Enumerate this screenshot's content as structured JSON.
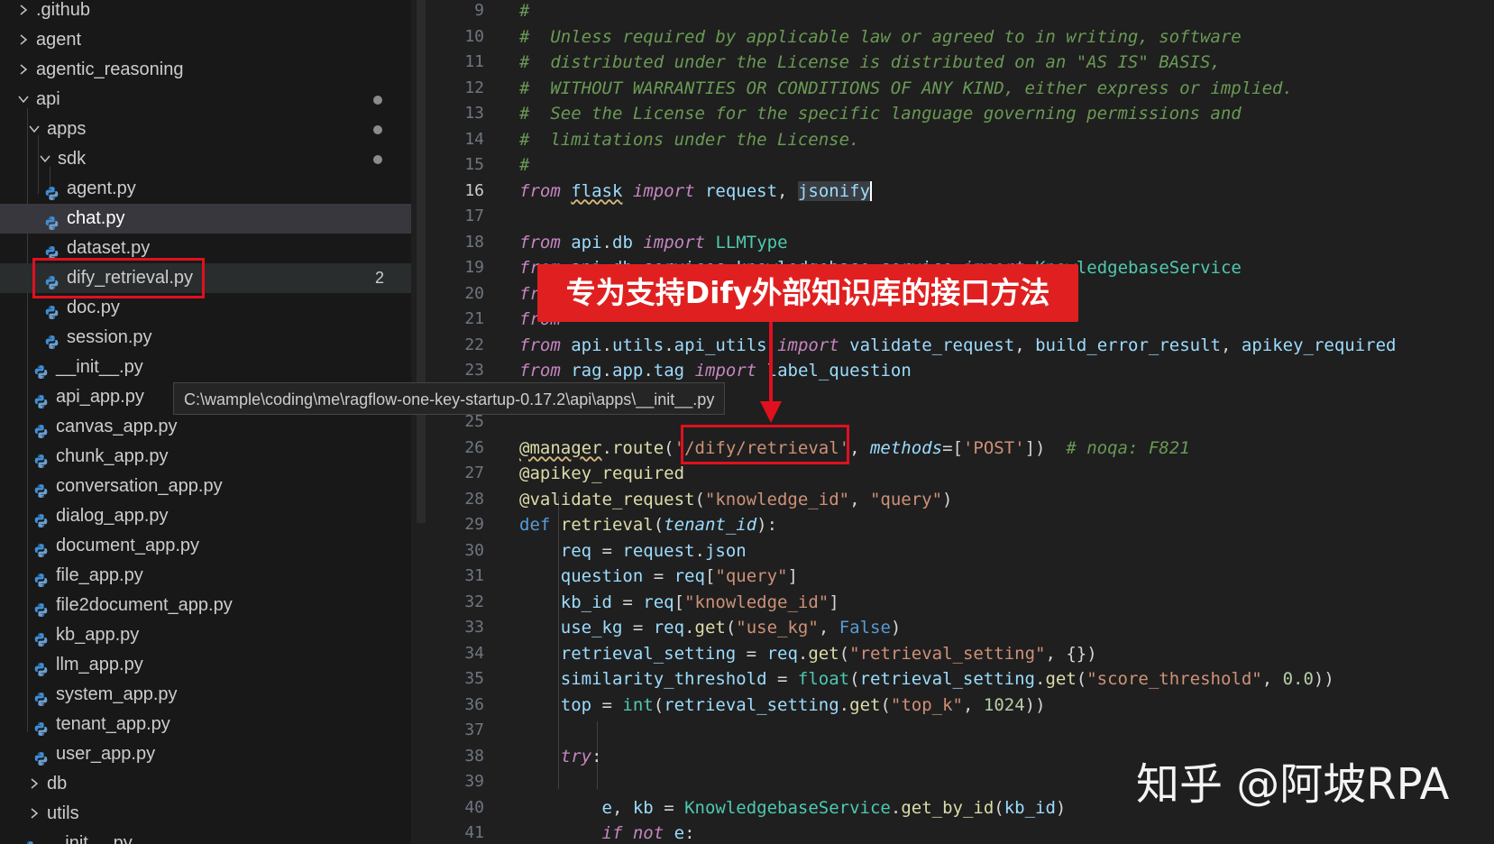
{
  "explorer": {
    "items": [
      {
        "label": ".github",
        "kind": "folder",
        "expanded": false
      },
      {
        "label": "agent",
        "kind": "folder",
        "expanded": false
      },
      {
        "label": "agentic_reasoning",
        "kind": "folder",
        "expanded": false
      },
      {
        "label": "api",
        "kind": "folder",
        "expanded": true
      },
      {
        "label": "apps",
        "kind": "folder",
        "expanded": true
      },
      {
        "label": "sdk",
        "kind": "folder",
        "expanded": true
      },
      {
        "label": "agent.py",
        "kind": "file"
      },
      {
        "label": "chat.py",
        "kind": "file",
        "selected": true
      },
      {
        "label": "dataset.py",
        "kind": "file"
      },
      {
        "label": "dify_retrieval.py",
        "kind": "file",
        "badge": "2"
      },
      {
        "label": "doc.py",
        "kind": "file"
      },
      {
        "label": "session.py",
        "kind": "file"
      },
      {
        "label": "__init__.py",
        "kind": "file"
      },
      {
        "label": "api_app.py",
        "kind": "file"
      },
      {
        "label": "canvas_app.py",
        "kind": "file"
      },
      {
        "label": "chunk_app.py",
        "kind": "file"
      },
      {
        "label": "conversation_app.py",
        "kind": "file"
      },
      {
        "label": "dialog_app.py",
        "kind": "file"
      },
      {
        "label": "document_app.py",
        "kind": "file"
      },
      {
        "label": "file_app.py",
        "kind": "file"
      },
      {
        "label": "file2document_app.py",
        "kind": "file"
      },
      {
        "label": "kb_app.py",
        "kind": "file"
      },
      {
        "label": "llm_app.py",
        "kind": "file"
      },
      {
        "label": "system_app.py",
        "kind": "file"
      },
      {
        "label": "tenant_app.py",
        "kind": "file"
      },
      {
        "label": "user_app.py",
        "kind": "file"
      },
      {
        "label": "db",
        "kind": "folder",
        "expanded": false
      },
      {
        "label": "utils",
        "kind": "folder",
        "expanded": false
      },
      {
        "label": "__init__.py",
        "kind": "file"
      }
    ],
    "tooltip": "C:\\wample\\coding\\me\\ragflow-one-key-startup-0.17.2\\api\\apps\\__init__.py"
  },
  "editor": {
    "active_line": "16",
    "line_numbers": [
      "9",
      "10",
      "11",
      "12",
      "13",
      "14",
      "15",
      "16",
      "17",
      "18",
      "19",
      "20",
      "21",
      "22",
      "23",
      "24",
      "25",
      "26",
      "27",
      "28",
      "29",
      "30",
      "31",
      "32",
      "33",
      "34",
      "35",
      "36",
      "37",
      "38",
      "39",
      "40",
      "41"
    ],
    "lines": [
      "#",
      "#  Unless required by applicable law or agreed to in writing, software",
      "#  distributed under the License is distributed on an \"AS IS\" BASIS,",
      "#  WITHOUT WARRANTIES OR CONDITIONS OF ANY KIND, either express or implied.",
      "#  See the License for the specific language governing permissions and",
      "#  limitations under the License.",
      "#",
      "from flask import request, jsonify",
      "",
      "from api.db import LLMType",
      "from api.db.services.knowledgebase_service import KnowledgebaseService",
      "from",
      "from",
      "from api.utils.api_utils import validate_request, build_error_result, apikey_required",
      "from rag.app.tag import label_question",
      "",
      "",
      "@manager.route('/dify/retrieval', methods=['POST'])  # noqa: F821",
      "@apikey_required",
      "@validate_request(\"knowledge_id\", \"query\")",
      "def retrieval(tenant_id):",
      "    req = request.json",
      "    question = req[\"query\"]",
      "    kb_id = req[\"knowledge_id\"]",
      "    use_kg = req.get(\"use_kg\", False)",
      "    retrieval_setting = req.get(\"retrieval_setting\", {})",
      "    similarity_threshold = float(retrieval_setting.get(\"score_threshold\", 0.0))",
      "    top = int(retrieval_setting.get(\"top_k\", 1024))",
      "",
      "    try:",
      "",
      "        e, kb = KnowledgebaseService.get_by_id(kb_id)",
      "        if not e:"
    ]
  },
  "annotation": {
    "banner": "专为支持Dify外部知识库的接口方法",
    "accent_color": "#e02020"
  },
  "watermark": "知乎 @阿坡RPA"
}
